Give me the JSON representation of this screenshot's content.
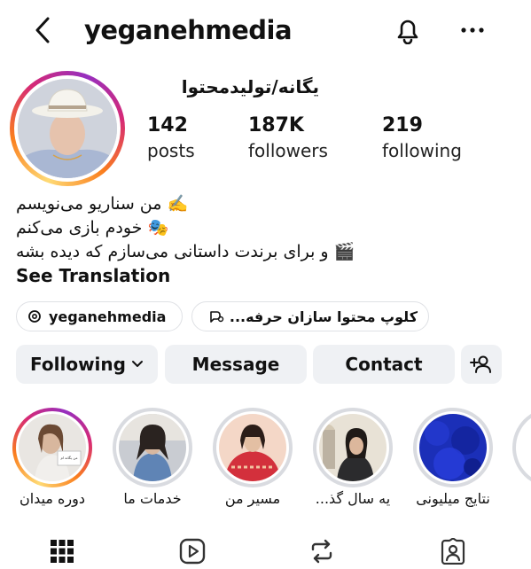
{
  "header": {
    "username": "yeganehmedia",
    "icons": [
      "back-arrow-icon",
      "bell-icon",
      "more-dots-icon"
    ]
  },
  "profile": {
    "display_name": "یگانه/تولیدمحتوا",
    "stats": [
      {
        "value": "142",
        "label": "posts"
      },
      {
        "value": "187K",
        "label": "followers"
      },
      {
        "value": "219",
        "label": "following"
      }
    ]
  },
  "bio": {
    "lines": [
      "✍️ من سناریو می‌نویسم",
      "🎭 خودم بازی می‌کنم",
      "🎬 و برای برندت داستانی می‌سازم که دیده بشه"
    ],
    "see_translation": "See Translation"
  },
  "chips": {
    "threads": "yeganehmedia",
    "group": "کلوپ محتوا سازان حرفه..."
  },
  "buttons": {
    "following": "Following",
    "message": "Message",
    "contact": "Contact"
  },
  "highlights": [
    {
      "label": "دوره میدان",
      "image_text": "من یگانه ام"
    },
    {
      "label": "خدمات ما"
    },
    {
      "label": "مسیر من"
    },
    {
      "label": "یه سال گذ..."
    },
    {
      "label": "نتایج میلیونی"
    }
  ],
  "tabs": [
    "grid-icon",
    "reels-icon",
    "reposts-icon",
    "tagged-icon"
  ],
  "colors": {
    "button_bg": "#eff1f4",
    "chip_border": "#dfe1e5",
    "story_ring_gray": "#d9dbe0"
  }
}
